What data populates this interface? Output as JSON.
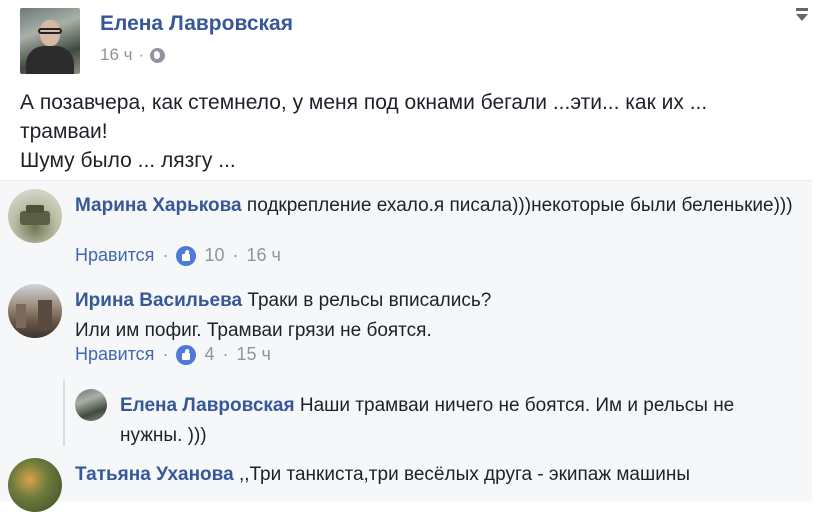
{
  "post": {
    "author": "Елена Лавровская",
    "time": "16 ч",
    "dot": "·",
    "text_lines": [
      "А позавчера, как стемнело, у меня под окнами бегали ...эти... как их ...",
      "трамваи!",
      "Шуму было ... лязгу ..."
    ]
  },
  "actions": {
    "like_label": "Нравится",
    "separator": "·"
  },
  "comments": [
    {
      "author": "Марина Харькова",
      "text": "подкрепление ехало.я писала)))некоторые были беленькие)))",
      "likes": "10",
      "time": "16 ч"
    },
    {
      "author": "Ирина Васильева",
      "text": "Траки в рельсы вписались?",
      "text2": "Или им пофиг. Трамваи грязи не боятся.",
      "likes": "4",
      "time": "15 ч"
    },
    {
      "author": "Татьяна Уханова",
      "text": ",,Три танкиста,три весёлых друга - экипаж машины"
    }
  ],
  "reply": {
    "author": "Елена Лавровская",
    "text": "Наши трамваи ничего не боятся. Им и рельсы не нужны. )))"
  }
}
